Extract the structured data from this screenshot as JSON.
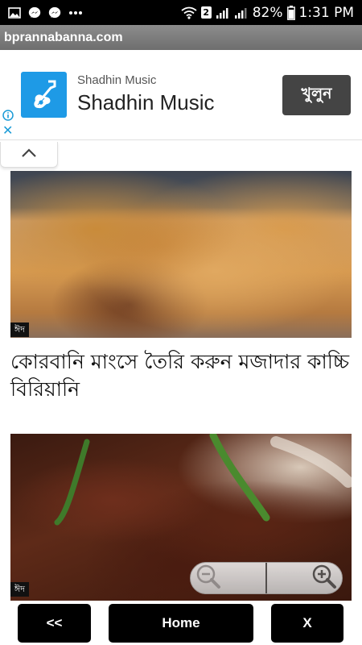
{
  "status_bar": {
    "left_icons": [
      "image-icon",
      "messenger-icon",
      "messenger-icon",
      "more-icon"
    ],
    "sim_number": "2",
    "battery": "82%",
    "time": "1:31 PM"
  },
  "browser": {
    "url": "bprannabanna.com"
  },
  "ad": {
    "advertiser_small": "Shadhin Music",
    "advertiser_big": "Shadhin Music",
    "cta": "খুলুন",
    "close_glyph": "✕",
    "brand_color": "#1e9ae6"
  },
  "articles": [
    {
      "tag": "ঈদ",
      "title": "কোরবানি মাংসে তৈরি করুন মজাদার কাচ্চি বিরিয়ানি"
    },
    {
      "tag": "ঈদ"
    }
  ],
  "nav": {
    "back": "<<",
    "home": "Home",
    "close": "X"
  }
}
